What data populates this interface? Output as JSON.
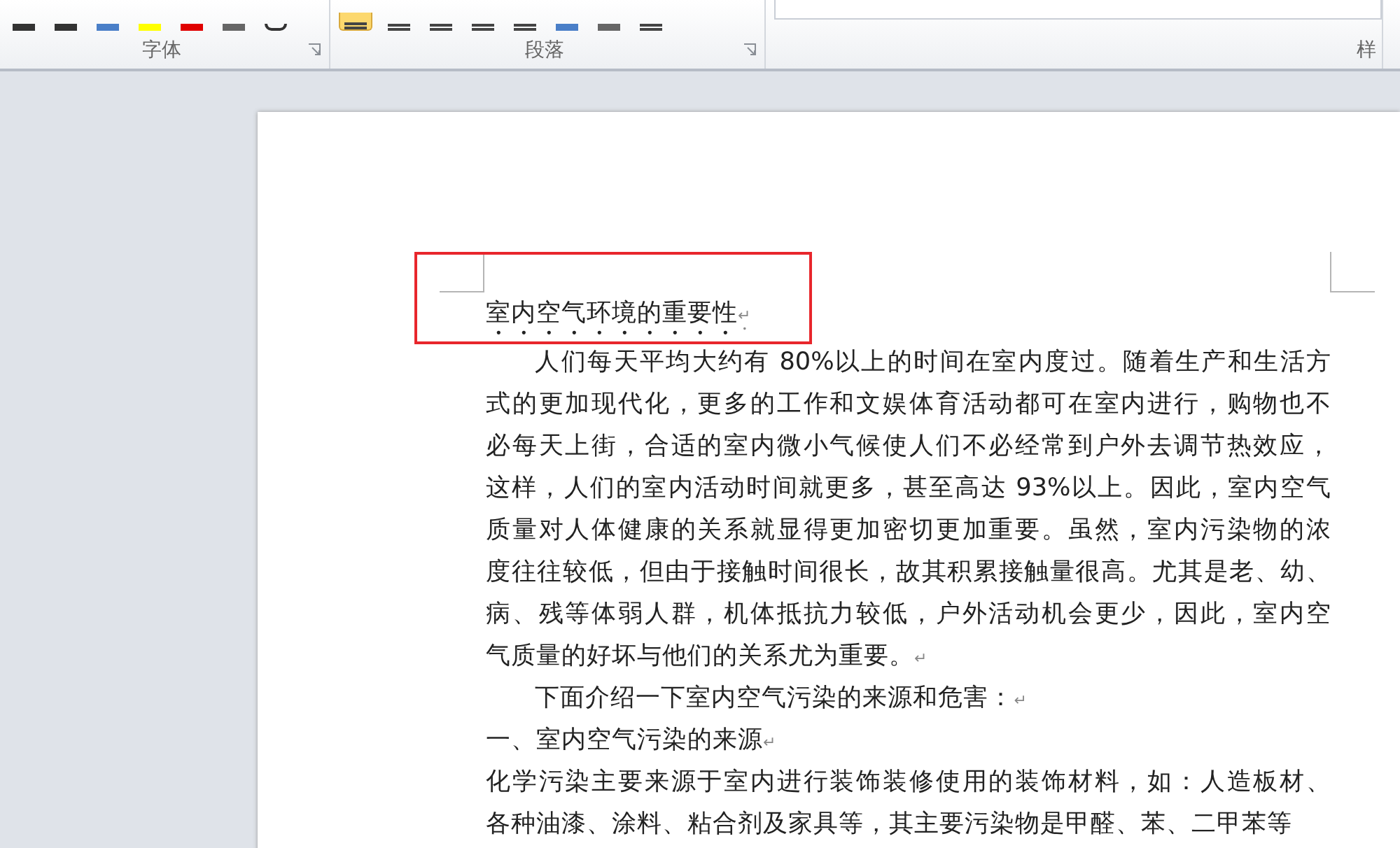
{
  "ribbon": {
    "groups": [
      {
        "label": "字体"
      },
      {
        "label": "段落"
      },
      {
        "label": "样"
      }
    ]
  },
  "document": {
    "title": {
      "text": "室内空气环境的重要性",
      "emphasis_dots": true,
      "mark": "↵"
    },
    "paragraphs": [
      {
        "lines": [
          "人们每天平均大约有 80%以上的时间在室内度过。随着生产和生活方",
          "式的更加现代化，更多的工作和文娱体育活动都可在室内进行，购物也不",
          "必每天上街，合适的室内微小气候使人们不必经常到户外去调节热效应，",
          "这样，人们的室内活动时间就更多，甚至高达 93%以上。因此，室内空气",
          "质量对人体健康的关系就显得更加密切更加重要。虽然，室内污染物的浓",
          "度往往较低，但由于接触时间很长，故其积累接触量很高。尤其是老、幼、",
          "病、残等体弱人群，机体抵抗力较低，户外活动机会更少，因此，室内空",
          "气质量的好坏与他们的关系尤为重要。"
        ],
        "indent": true,
        "mark": "↵"
      },
      {
        "lines": [
          "下面介绍一下室内空气污染的来源和危害："
        ],
        "indent": true,
        "mark": "↵"
      },
      {
        "lines": [
          "一、室内空气污染的来源"
        ],
        "indent": false,
        "mark": "↵"
      },
      {
        "lines": [
          "化学污染主要来源于室内进行装饰装修使用的装饰材料，如：人造板材、",
          "各种油漆、涂料、粘合剂及家具等，其主要污染物是甲醛、苯、二甲苯等"
        ],
        "indent": false
      }
    ]
  }
}
